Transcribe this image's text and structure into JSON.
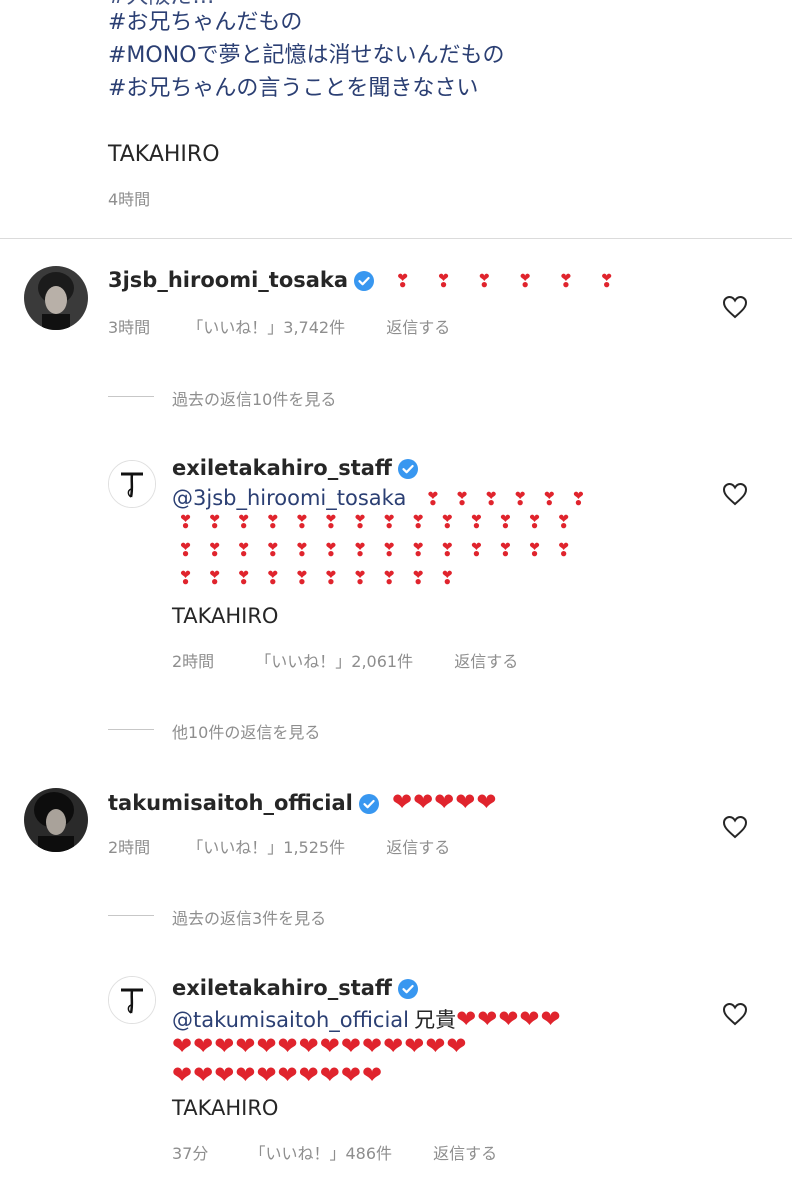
{
  "caption": {
    "hashtags": [
      "#お兄ちゃんだもの",
      "#MONOで夢と記憶は消せないんだもの",
      "#お兄ちゃんの言うことを聞きなさい"
    ],
    "signature": "TAKAHIRO",
    "time": "4時間"
  },
  "comments": [
    {
      "username": "3jsb_hiroomi_tosaka",
      "text": "❣ ❣ ❣ ❣ ❣ ❣",
      "time": "3時間",
      "likes": "「いいね！」3,742件",
      "reply": "返信する"
    },
    {
      "view_replies": "過去の返信10件を見る"
    },
    {
      "username": "exiletakahiro_staff",
      "mention": "@3jsb_hiroomi_tosaka",
      "hearts_line1": "❣❣❣❣❣❣",
      "hearts_line2": "❣❣❣❣❣❣❣❣❣❣❣❣❣❣",
      "hearts_line3": "❣❣❣❣❣❣❣❣❣❣❣❣❣❣",
      "hearts_line4": "❣❣❣❣❣❣❣❣❣❣",
      "signature": "TAKAHIRO",
      "time": "2時間",
      "likes": "「いいね！」2,061件",
      "reply": "返信する"
    },
    {
      "view_replies": "他10件の返信を見る"
    },
    {
      "username": "takumisaitoh_official",
      "text": "❤❤❤❤❤",
      "time": "2時間",
      "likes": "「いいね！」1,525件",
      "reply": "返信する"
    },
    {
      "view_replies": "過去の返信3件を見る"
    },
    {
      "username": "exiletakahiro_staff",
      "mention": "@takumisaitoh_official",
      "word": "兄貴",
      "hearts_line1": "❤❤❤❤❤",
      "hearts_line2": "❤❤❤❤❤❤❤❤❤❤❤❤❤❤",
      "hearts_line3": "❤❤❤❤❤❤❤❤❤❤",
      "signature": "TAKAHIRO",
      "time": "37分",
      "likes": "「いいね！」486件",
      "reply": "返信する"
    }
  ],
  "colors": {
    "hashtag": "#2b3f73",
    "heart": "#e0242d",
    "verified": "#3897f0",
    "muted": "#8e8e8e"
  },
  "icons": {
    "like": "heart-outline-icon",
    "verified": "verified-badge-icon"
  }
}
